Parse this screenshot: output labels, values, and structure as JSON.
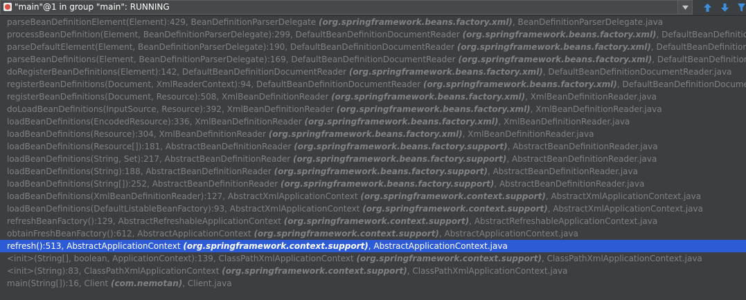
{
  "toolbar": {
    "thread_label": "\"main\"@1 in group \"main\": RUNNING",
    "icons": [
      "thread-icon",
      "dropdown-arrow-icon",
      "arrow-up-icon",
      "arrow-down-icon",
      "filter-icon"
    ]
  },
  "colors": {
    "background": "#3c3f41",
    "frame_text": "#7f8183",
    "selected_background": "#2d5bd5",
    "selected_text": "#ffffff",
    "toolbar_icon": "#3d8fe0"
  },
  "frames": [
    {
      "method": "parseBeanDefinitionElement(Element):429, BeanDefinitionParserDelegate ",
      "pkg": "(org.springframework.beans.factory.xml)",
      "file": ", BeanDefinitionParserDelegate.java"
    },
    {
      "method": "processBeanDefinition(Element, BeanDefinitionParserDelegate):299, DefaultBeanDefinitionDocumentReader ",
      "pkg": "(org.springframework.beans.factory.xml)",
      "file": ", DefaultBeanDefinitionDocumentReader.java"
    },
    {
      "method": "parseDefaultElement(Element, BeanDefinitionParserDelegate):190, DefaultBeanDefinitionDocumentReader ",
      "pkg": "(org.springframework.beans.factory.xml)",
      "file": ", DefaultBeanDefinitionDocumentReader.java"
    },
    {
      "method": "parseBeanDefinitions(Element, BeanDefinitionParserDelegate):169, DefaultBeanDefinitionDocumentReader ",
      "pkg": "(org.springframework.beans.factory.xml)",
      "file": ", DefaultBeanDefinitionDocumentReader.java"
    },
    {
      "method": "doRegisterBeanDefinitions(Element):142, DefaultBeanDefinitionDocumentReader ",
      "pkg": "(org.springframework.beans.factory.xml)",
      "file": ", DefaultBeanDefinitionDocumentReader.java"
    },
    {
      "method": "registerBeanDefinitions(Document, XmlReaderContext):94, DefaultBeanDefinitionDocumentReader ",
      "pkg": "(org.springframework.beans.factory.xml)",
      "file": ", DefaultBeanDefinitionDocumentReader.java"
    },
    {
      "method": "registerBeanDefinitions(Document, Resource):508, XmlBeanDefinitionReader ",
      "pkg": "(org.springframework.beans.factory.xml)",
      "file": ", XmlBeanDefinitionReader.java"
    },
    {
      "method": "doLoadBeanDefinitions(InputSource, Resource):392, XmlBeanDefinitionReader ",
      "pkg": "(org.springframework.beans.factory.xml)",
      "file": ", XmlBeanDefinitionReader.java"
    },
    {
      "method": "loadBeanDefinitions(EncodedResource):336, XmlBeanDefinitionReader ",
      "pkg": "(org.springframework.beans.factory.xml)",
      "file": ", XmlBeanDefinitionReader.java"
    },
    {
      "method": "loadBeanDefinitions(Resource):304, XmlBeanDefinitionReader ",
      "pkg": "(org.springframework.beans.factory.xml)",
      "file": ", XmlBeanDefinitionReader.java"
    },
    {
      "method": "loadBeanDefinitions(Resource[]):181, AbstractBeanDefinitionReader ",
      "pkg": "(org.springframework.beans.factory.support)",
      "file": ", AbstractBeanDefinitionReader.java"
    },
    {
      "method": "loadBeanDefinitions(String, Set):217, AbstractBeanDefinitionReader ",
      "pkg": "(org.springframework.beans.factory.support)",
      "file": ", AbstractBeanDefinitionReader.java"
    },
    {
      "method": "loadBeanDefinitions(String):188, AbstractBeanDefinitionReader ",
      "pkg": "(org.springframework.beans.factory.support)",
      "file": ", AbstractBeanDefinitionReader.java"
    },
    {
      "method": "loadBeanDefinitions(String[]):252, AbstractBeanDefinitionReader ",
      "pkg": "(org.springframework.beans.factory.support)",
      "file": ", AbstractBeanDefinitionReader.java"
    },
    {
      "method": "loadBeanDefinitions(XmlBeanDefinitionReader):127, AbstractXmlApplicationContext ",
      "pkg": "(org.springframework.context.support)",
      "file": ", AbstractXmlApplicationContext.java"
    },
    {
      "method": "loadBeanDefinitions(DefaultListableBeanFactory):93, AbstractXmlApplicationContext ",
      "pkg": "(org.springframework.context.support)",
      "file": ", AbstractXmlApplicationContext.java"
    },
    {
      "method": "refreshBeanFactory():129, AbstractRefreshableApplicationContext ",
      "pkg": "(org.springframework.context.support)",
      "file": ", AbstractRefreshableApplicationContext.java"
    },
    {
      "method": "obtainFreshBeanFactory():612, AbstractApplicationContext ",
      "pkg": "(org.springframework.context.support)",
      "file": ", AbstractApplicationContext.java"
    },
    {
      "method": "refresh():513, AbstractApplicationContext ",
      "pkg": "(org.springframework.context.support)",
      "file": ", AbstractApplicationContext.java",
      "selected": true
    },
    {
      "method": "<init>(String[], boolean, ApplicationContext):139, ClassPathXmlApplicationContext ",
      "pkg": "(org.springframework.context.support)",
      "file": ", ClassPathXmlApplicationContext.java"
    },
    {
      "method": "<init>(String):83, ClassPathXmlApplicationContext ",
      "pkg": "(org.springframework.context.support)",
      "file": ", ClassPathXmlApplicationContext.java"
    },
    {
      "method": "main(String[]):16, Client ",
      "pkg": "(com.nemotan)",
      "file": ", Client.java"
    }
  ]
}
